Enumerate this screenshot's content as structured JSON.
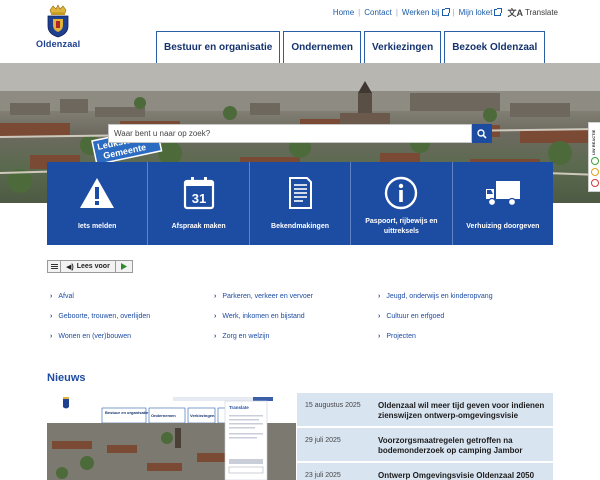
{
  "brand": {
    "name": "Oldenzaal",
    "subtitle": "Gemeente"
  },
  "topnav": {
    "home": "Home",
    "contact": "Contact",
    "werken_bij": "Werken bij",
    "mijn_loket": "Mijn loket",
    "translate": "Translate"
  },
  "mainnav": [
    "Bestuur en organisatie",
    "Ondernemen",
    "Verkiezingen",
    "Bezoek Oldenzaal"
  ],
  "hero": {
    "badge_line1": "Leukste",
    "badge_line2": "Gemeente",
    "search_placeholder": "Waar bent u naar op zoek?"
  },
  "reactie": {
    "label": "UW REACTIE"
  },
  "tiles": [
    {
      "label": "Iets melden",
      "icon": "warning-icon"
    },
    {
      "label": "Afspraak maken",
      "icon": "calendar-icon",
      "day": "31"
    },
    {
      "label": "Bekendmakingen",
      "icon": "document-icon"
    },
    {
      "label": "Paspoort, rijbewijs en uittreksels",
      "icon": "info-icon"
    },
    {
      "label": "Verhuizing doorgeven",
      "icon": "truck-icon"
    }
  ],
  "readspeaker": {
    "label": "Lees voor"
  },
  "links": {
    "col1": [
      "Afval",
      "Geboorte, trouwen, overlijden",
      "Wonen en (ver)bouwen"
    ],
    "col2": [
      "Parkeren, verkeer en vervoer",
      "Werk, inkomen en bijstand",
      "Zorg en welzijn"
    ],
    "col3": [
      "Jeugd, onderwijs en kinderopvang",
      "Cultuur en erfgoed",
      "Projecten"
    ]
  },
  "news": {
    "title": "Nieuws",
    "items": [
      {
        "date": "15 augustus 2025",
        "headline": "Oldenzaal wil meer tijd geven voor indienen zienswijzen ontwerp-omgevingsvisie"
      },
      {
        "date": "29 juli 2025",
        "headline": "Voorzorgsmaatregelen getroffen na bodemonderzoek op camping Jambor"
      },
      {
        "date": "23 juli 2025",
        "headline": "Ontwerp Omgevingsvisie Oldenzaal 2050"
      }
    ],
    "thumb": {
      "nav": [
        "Bestuur en organisatie",
        "Ondernemen",
        "Verkiezingen",
        "Bezoek Oldenzaal"
      ],
      "panel_title": "Translate"
    }
  },
  "colors": {
    "primary": "#1d4ca3",
    "nav_text": "#14326e",
    "news_bg": "#d9e4f1"
  }
}
